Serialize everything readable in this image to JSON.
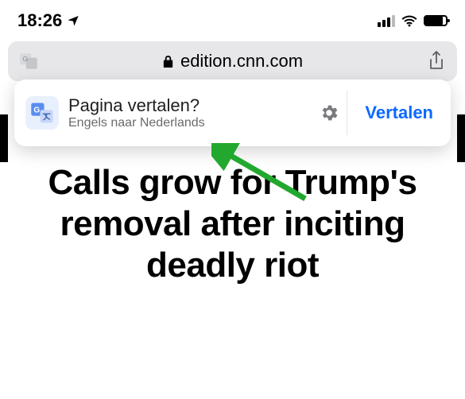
{
  "status_bar": {
    "time": "18:26"
  },
  "url_bar": {
    "domain": "edition.cnn.com"
  },
  "translate_popup": {
    "title": "Pagina vertalen?",
    "subtitle": "Engels naar Nederlands",
    "action": "Vertalen"
  },
  "page": {
    "headline": "Calls grow for Trump's removal after inciting deadly riot"
  },
  "colors": {
    "action_blue": "#0a69ff",
    "arrow_green": "#22a82e"
  }
}
